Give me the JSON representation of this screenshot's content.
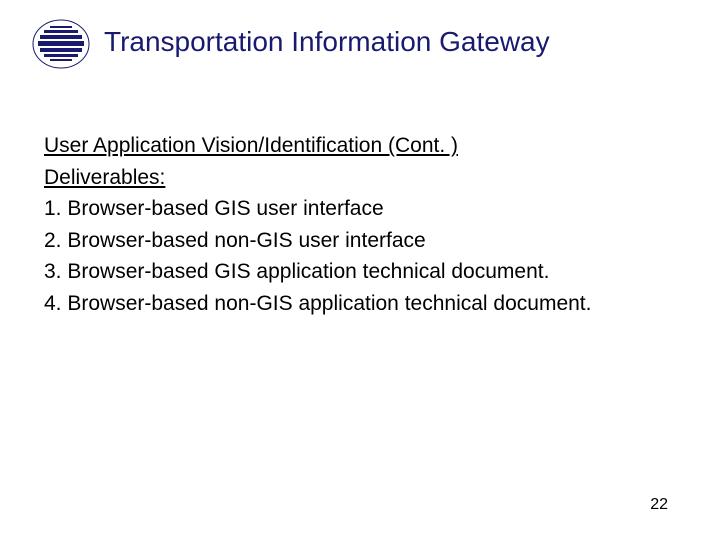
{
  "title": "Transportation Information Gateway",
  "section_heading": "User Application Vision/Identification (Cont. )",
  "deliverables_label": "Deliverables:",
  "items": [
    "1. Browser-based GIS user interface",
    "2. Browser-based non-GIS user interface",
    "3. Browser-based GIS application technical document.",
    "4. Browser-based non-GIS application technical document."
  ],
  "page_number": "22"
}
